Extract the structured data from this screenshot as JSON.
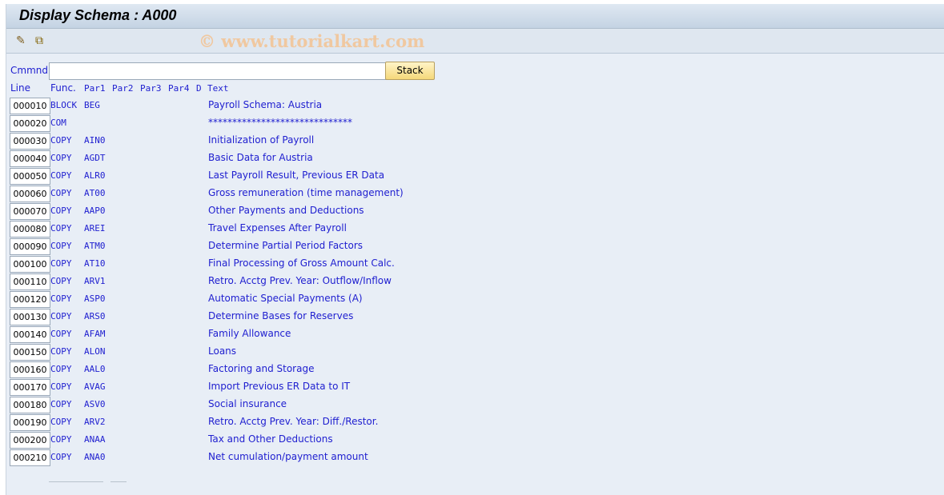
{
  "title": "Display Schema : A000",
  "watermark": "© www.tutorialkart.com",
  "toolbar": {
    "icons": [
      "display-change-icon",
      "other-object-icon"
    ]
  },
  "command": {
    "label": "Cmmnd",
    "value": "",
    "stack_label": "Stack"
  },
  "columns": {
    "line": "Line",
    "func": "Func.",
    "par1": "Par1",
    "par2": "Par2",
    "par3": "Par3",
    "par4": "Par4",
    "d": "D",
    "text": "Text"
  },
  "rows": [
    {
      "line": "000010",
      "func": "BLOCK",
      "par1": "BEG",
      "text": "Payroll Schema: Austria"
    },
    {
      "line": "000020",
      "func": "COM",
      "par1": "",
      "text": "******************************"
    },
    {
      "line": "000030",
      "func": "COPY",
      "par1": "AIN0",
      "text": "Initialization of Payroll"
    },
    {
      "line": "000040",
      "func": "COPY",
      "par1": "AGDT",
      "text": "Basic Data for Austria"
    },
    {
      "line": "000050",
      "func": "COPY",
      "par1": "ALR0",
      "text": "Last Payroll Result, Previous ER Data"
    },
    {
      "line": "000060",
      "func": "COPY",
      "par1": "AT00",
      "text": "Gross remuneration (time management)"
    },
    {
      "line": "000070",
      "func": "COPY",
      "par1": "AAP0",
      "text": "Other Payments and Deductions"
    },
    {
      "line": "000080",
      "func": "COPY",
      "par1": "AREI",
      "text": "Travel Expenses After Payroll"
    },
    {
      "line": "000090",
      "func": "COPY",
      "par1": "ATM0",
      "text": "Determine Partial Period Factors"
    },
    {
      "line": "000100",
      "func": "COPY",
      "par1": "AT10",
      "text": "Final Processing of Gross Amount Calc."
    },
    {
      "line": "000110",
      "func": "COPY",
      "par1": "ARV1",
      "text": "Retro. Acctg Prev. Year: Outflow/Inflow"
    },
    {
      "line": "000120",
      "func": "COPY",
      "par1": "ASP0",
      "text": "Automatic Special Payments (A)"
    },
    {
      "line": "000130",
      "func": "COPY",
      "par1": "ARS0",
      "text": "Determine Bases for Reserves"
    },
    {
      "line": "000140",
      "func": "COPY",
      "par1": "AFAM",
      "text": "Family Allowance"
    },
    {
      "line": "000150",
      "func": "COPY",
      "par1": "ALON",
      "text": "Loans"
    },
    {
      "line": "000160",
      "func": "COPY",
      "par1": "AAL0",
      "text": "Factoring and Storage"
    },
    {
      "line": "000170",
      "func": "COPY",
      "par1": "AVAG",
      "text": "Import Previous ER Data to IT"
    },
    {
      "line": "000180",
      "func": "COPY",
      "par1": "ASV0",
      "text": "Social insurance"
    },
    {
      "line": "000190",
      "func": "COPY",
      "par1": "ARV2",
      "text": "Retro. Acctg Prev. Year: Diff./Restor."
    },
    {
      "line": "000200",
      "func": "COPY",
      "par1": "ANAA",
      "text": "Tax and Other Deductions"
    },
    {
      "line": "000210",
      "func": "COPY",
      "par1": "ANA0",
      "text": "Net cumulation/payment amount"
    }
  ]
}
